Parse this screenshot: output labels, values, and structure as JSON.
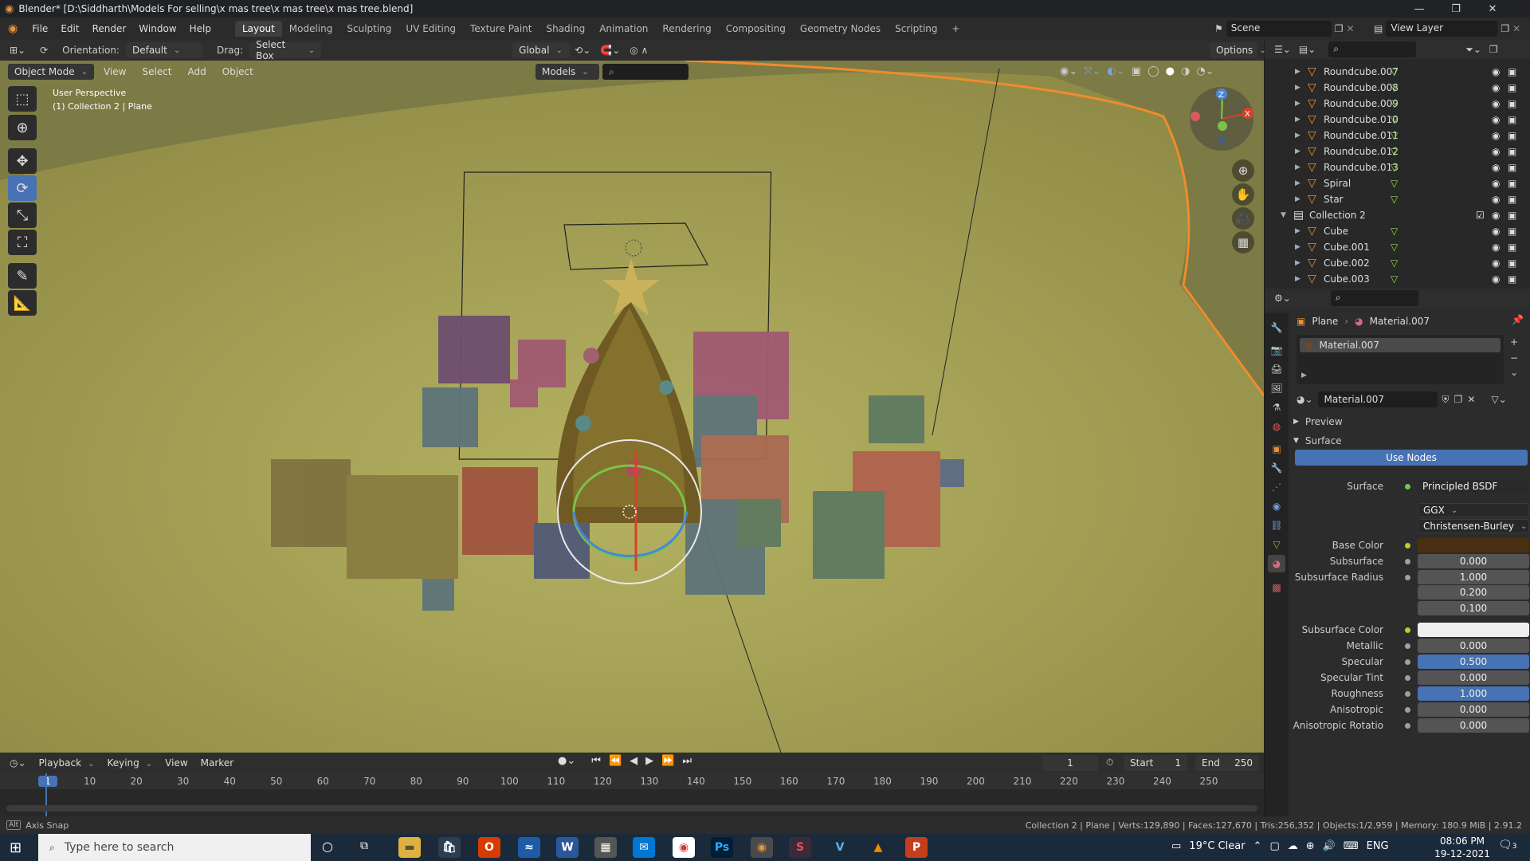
{
  "window": {
    "title": "Blender* [D:\\Siddharth\\Models For selling\\x mas tree\\x mas tree\\x mas tree.blend]"
  },
  "menu": [
    "File",
    "Edit",
    "Render",
    "Window",
    "Help"
  ],
  "workspaces": [
    "Layout",
    "Modeling",
    "Sculpting",
    "UV Editing",
    "Texture Paint",
    "Shading",
    "Animation",
    "Rendering",
    "Compositing",
    "Geometry Nodes",
    "Scripting"
  ],
  "active_workspace": "Layout",
  "scene": {
    "scene_name": "Scene",
    "view_layer": "View Layer"
  },
  "viewport_header": {
    "orientation_label": "Orientation:",
    "orientation_value": "Default",
    "drag_label": "Drag:",
    "drag_value": "Select Box",
    "transform_orientation": "Global",
    "options": "Options",
    "mode": "Object Mode",
    "menus": [
      "View",
      "Select",
      "Add",
      "Object"
    ],
    "models_dropdown": "Models"
  },
  "viewport": {
    "perspective": "User Perspective",
    "object_info": "(1) Collection 2 | Plane",
    "background_color": "#8a8a4a",
    "floor_color": "#b0ac5c"
  },
  "outliner": {
    "rows": [
      {
        "label": "Roundcube.007",
        "type": "object"
      },
      {
        "label": "Roundcube.008",
        "type": "object"
      },
      {
        "label": "Roundcube.009",
        "type": "object"
      },
      {
        "label": "Roundcube.010",
        "type": "object"
      },
      {
        "label": "Roundcube.011",
        "type": "object"
      },
      {
        "label": "Roundcube.012",
        "type": "object"
      },
      {
        "label": "Roundcube.013",
        "type": "object"
      },
      {
        "label": "Spiral",
        "type": "object"
      },
      {
        "label": "Star",
        "type": "object"
      },
      {
        "label": "Collection 2",
        "type": "collection"
      },
      {
        "label": "Cube",
        "type": "object"
      },
      {
        "label": "Cube.001",
        "type": "object"
      },
      {
        "label": "Cube.002",
        "type": "object"
      },
      {
        "label": "Cube.003",
        "type": "object"
      }
    ]
  },
  "properties": {
    "breadcrumb_object": "Plane",
    "breadcrumb_material": "Material.007",
    "slot_name": "Material.007",
    "material_name": "Material.007",
    "preview_label": "Preview",
    "surface_section": "Surface",
    "use_nodes": "Use Nodes",
    "surface_label": "Surface",
    "surface_shader": "Principled BSDF",
    "distribution": "GGX",
    "subsurface_method": "Christensen-Burley",
    "fields": [
      {
        "label": "Base Color",
        "value": "",
        "kind": "color",
        "color": "#4a2e12"
      },
      {
        "label": "Subsurface",
        "value": "0.000",
        "kind": "num"
      },
      {
        "label": "Subsurface Radius",
        "value": "1.000",
        "kind": "num"
      },
      {
        "label": "",
        "value": "0.200",
        "kind": "num"
      },
      {
        "label": "",
        "value": "0.100",
        "kind": "num"
      },
      {
        "label": "Subsurface Color",
        "value": "",
        "kind": "color",
        "color": "#eeeeee"
      },
      {
        "label": "Metallic",
        "value": "0.000",
        "kind": "num"
      },
      {
        "label": "Specular",
        "value": "0.500",
        "kind": "blue"
      },
      {
        "label": "Specular Tint",
        "value": "0.000",
        "kind": "num"
      },
      {
        "label": "Roughness",
        "value": "1.000",
        "kind": "blue"
      },
      {
        "label": "Anisotropic",
        "value": "0.000",
        "kind": "num"
      },
      {
        "label": "Anisotropic Rotatio",
        "value": "0.000",
        "kind": "num"
      }
    ]
  },
  "timeline": {
    "menus": [
      "Playback",
      "Keying",
      "View",
      "Marker"
    ],
    "current_frame": "1",
    "start_label": "Start",
    "start_value": "1",
    "end_label": "End",
    "end_value": "250",
    "ticks": [
      "1",
      "10",
      "20",
      "30",
      "40",
      "50",
      "60",
      "70",
      "80",
      "90",
      "100",
      "110",
      "120",
      "130",
      "140",
      "150",
      "160",
      "170",
      "180",
      "190",
      "200",
      "210",
      "220",
      "230",
      "240",
      "250"
    ]
  },
  "status": {
    "left": "Axis Snap",
    "right": "Collection 2 | Plane | Verts:129,890 | Faces:127,670 | Tris:256,352 | Objects:1/2,959 | Memory: 180.9 MiB | 2.91.2"
  },
  "taskbar": {
    "search_placeholder": "Type here to search",
    "weather": "19°C  Clear",
    "lang": "ENG",
    "time": "08:06 PM",
    "date": "19-12-2021",
    "notifications": "3"
  }
}
